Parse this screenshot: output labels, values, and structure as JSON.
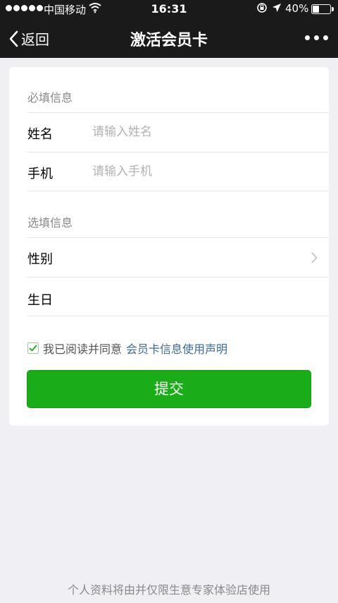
{
  "status_bar": {
    "carrier": "中国移动",
    "time": "16:31",
    "battery_percent": "40%",
    "battery_level": 0.4,
    "icons": [
      "signal-dots-icon",
      "wifi-icon",
      "rotation-lock-icon",
      "location-arrow-icon",
      "battery-icon"
    ]
  },
  "nav": {
    "back_label": "返回",
    "title": "激活会员卡",
    "more_icon": "ellipsis-icon"
  },
  "form": {
    "required_section": "必填信息",
    "optional_section": "选填信息",
    "name": {
      "label": "姓名",
      "placeholder": "请输入姓名",
      "value": ""
    },
    "phone": {
      "label": "手机",
      "placeholder": "请输入手机",
      "value": ""
    },
    "gender": {
      "label": "性别"
    },
    "birthday": {
      "label": "生日"
    },
    "agree": {
      "checked": true,
      "text": "我已阅读并同意",
      "link": "会员卡信息使用声明"
    },
    "submit_label": "提交"
  },
  "footer_text": "个人资料将由并仅限生意专家体验店使用",
  "colors": {
    "header_bg": "#1a1a1a",
    "page_bg": "#efeff4",
    "accent_green": "#1aad19",
    "link_blue": "#3e6a9e"
  }
}
